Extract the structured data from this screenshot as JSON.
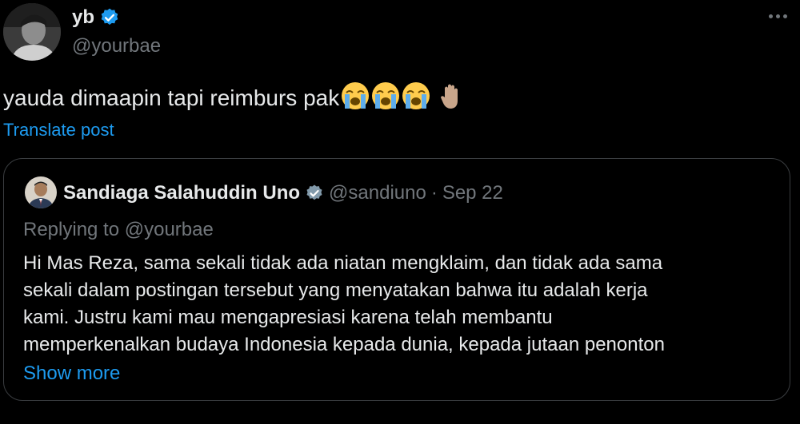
{
  "post": {
    "author": {
      "display_name": "yb",
      "handle": "@yourbae",
      "verified": true
    },
    "text": "yauda dimaapin tapi reimburs pak",
    "emojis": [
      "loudly-crying-face",
      "loudly-crying-face",
      "loudly-crying-face",
      "raised-hand"
    ],
    "translate_label": "Translate post",
    "more_icon": "more-horizontal-icon"
  },
  "quote": {
    "author": {
      "display_name": "Sandiaga Salahuddin Uno",
      "handle": "@sandiuno",
      "verified": true
    },
    "separator": "·",
    "date": "Sep 22",
    "replying_to": "Replying to @yourbae",
    "body_lines": [
      "Hi Mas Reza, sama sekali tidak ada niatan mengklaim, dan tidak ada sama",
      "sekali dalam postingan tersebut yang menyatakan bahwa itu adalah kerja",
      "kami. Justru kami mau mengapresiasi karena telah membantu",
      "memperkenalkan budaya Indonesia kepada dunia, kepada jutaan penonton"
    ],
    "show_more_label": "Show more"
  },
  "colors": {
    "background": "#000000",
    "text": "#e7e9ea",
    "secondary": "#71767b",
    "accent": "#1d9bf0",
    "border": "#3a3d40"
  }
}
